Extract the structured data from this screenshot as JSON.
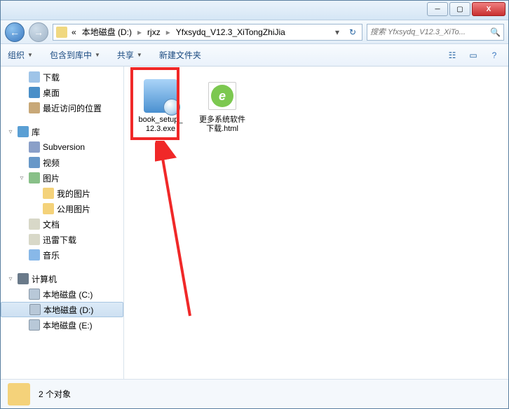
{
  "window": {
    "min": "─",
    "max": "▢",
    "close": "X"
  },
  "nav": {
    "back": "←",
    "fwd": "→"
  },
  "address": {
    "prefix": "«",
    "seg1": "本地磁盘 (D:)",
    "seg2": "rjxz",
    "seg3": "Yfxsydq_V12.3_XiTongZhiJia",
    "sep": "▸",
    "drop": "▾",
    "refresh": "↻"
  },
  "search": {
    "placeholder": "搜索 Yfxsydq_V12.3_XiTo...",
    "icon": "🔍"
  },
  "toolbar": {
    "organize": "组织",
    "include": "包含到库中",
    "share": "共享",
    "newfolder": "新建文件夹",
    "drop": "▼"
  },
  "tree": {
    "downloads": "下载",
    "desktop": "桌面",
    "recent": "最近访问的位置",
    "library": "库",
    "subversion": "Subversion",
    "video": "视频",
    "pictures": "图片",
    "mypics": "我的图片",
    "pubpics": "公用图片",
    "docs": "文档",
    "xldl": "迅雷下载",
    "music": "音乐",
    "computer": "计算机",
    "drivec": "本地磁盘 (C:)",
    "drived": "本地磁盘 (D:)",
    "drivee": "本地磁盘 (E:)"
  },
  "files": {
    "item1": "book_setup_12.3.exe",
    "item2": "更多系统软件下载.html"
  },
  "status": {
    "count": "2 个对象"
  }
}
